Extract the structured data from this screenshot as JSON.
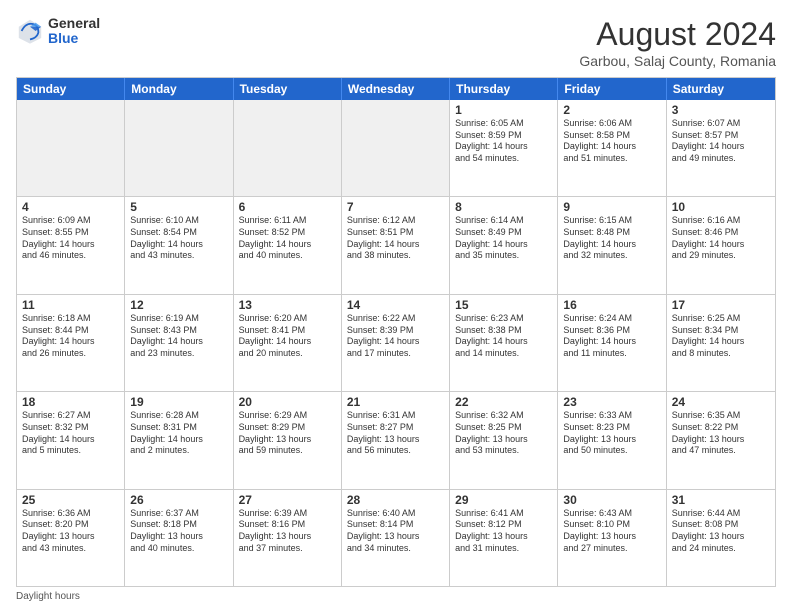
{
  "logo": {
    "general": "General",
    "blue": "Blue"
  },
  "title": "August 2024",
  "location": "Garbou, Salaj County, Romania",
  "days_of_week": [
    "Sunday",
    "Monday",
    "Tuesday",
    "Wednesday",
    "Thursday",
    "Friday",
    "Saturday"
  ],
  "footer": "Daylight hours",
  "weeks": [
    [
      {
        "day": "",
        "info": "",
        "shaded": true
      },
      {
        "day": "",
        "info": "",
        "shaded": true
      },
      {
        "day": "",
        "info": "",
        "shaded": true
      },
      {
        "day": "",
        "info": "",
        "shaded": true
      },
      {
        "day": "1",
        "info": "Sunrise: 6:05 AM\nSunset: 8:59 PM\nDaylight: 14 hours\nand 54 minutes."
      },
      {
        "day": "2",
        "info": "Sunrise: 6:06 AM\nSunset: 8:58 PM\nDaylight: 14 hours\nand 51 minutes."
      },
      {
        "day": "3",
        "info": "Sunrise: 6:07 AM\nSunset: 8:57 PM\nDaylight: 14 hours\nand 49 minutes."
      }
    ],
    [
      {
        "day": "4",
        "info": "Sunrise: 6:09 AM\nSunset: 8:55 PM\nDaylight: 14 hours\nand 46 minutes."
      },
      {
        "day": "5",
        "info": "Sunrise: 6:10 AM\nSunset: 8:54 PM\nDaylight: 14 hours\nand 43 minutes."
      },
      {
        "day": "6",
        "info": "Sunrise: 6:11 AM\nSunset: 8:52 PM\nDaylight: 14 hours\nand 40 minutes."
      },
      {
        "day": "7",
        "info": "Sunrise: 6:12 AM\nSunset: 8:51 PM\nDaylight: 14 hours\nand 38 minutes."
      },
      {
        "day": "8",
        "info": "Sunrise: 6:14 AM\nSunset: 8:49 PM\nDaylight: 14 hours\nand 35 minutes."
      },
      {
        "day": "9",
        "info": "Sunrise: 6:15 AM\nSunset: 8:48 PM\nDaylight: 14 hours\nand 32 minutes."
      },
      {
        "day": "10",
        "info": "Sunrise: 6:16 AM\nSunset: 8:46 PM\nDaylight: 14 hours\nand 29 minutes."
      }
    ],
    [
      {
        "day": "11",
        "info": "Sunrise: 6:18 AM\nSunset: 8:44 PM\nDaylight: 14 hours\nand 26 minutes."
      },
      {
        "day": "12",
        "info": "Sunrise: 6:19 AM\nSunset: 8:43 PM\nDaylight: 14 hours\nand 23 minutes."
      },
      {
        "day": "13",
        "info": "Sunrise: 6:20 AM\nSunset: 8:41 PM\nDaylight: 14 hours\nand 20 minutes."
      },
      {
        "day": "14",
        "info": "Sunrise: 6:22 AM\nSunset: 8:39 PM\nDaylight: 14 hours\nand 17 minutes."
      },
      {
        "day": "15",
        "info": "Sunrise: 6:23 AM\nSunset: 8:38 PM\nDaylight: 14 hours\nand 14 minutes."
      },
      {
        "day": "16",
        "info": "Sunrise: 6:24 AM\nSunset: 8:36 PM\nDaylight: 14 hours\nand 11 minutes."
      },
      {
        "day": "17",
        "info": "Sunrise: 6:25 AM\nSunset: 8:34 PM\nDaylight: 14 hours\nand 8 minutes."
      }
    ],
    [
      {
        "day": "18",
        "info": "Sunrise: 6:27 AM\nSunset: 8:32 PM\nDaylight: 14 hours\nand 5 minutes."
      },
      {
        "day": "19",
        "info": "Sunrise: 6:28 AM\nSunset: 8:31 PM\nDaylight: 14 hours\nand 2 minutes."
      },
      {
        "day": "20",
        "info": "Sunrise: 6:29 AM\nSunset: 8:29 PM\nDaylight: 13 hours\nand 59 minutes."
      },
      {
        "day": "21",
        "info": "Sunrise: 6:31 AM\nSunset: 8:27 PM\nDaylight: 13 hours\nand 56 minutes."
      },
      {
        "day": "22",
        "info": "Sunrise: 6:32 AM\nSunset: 8:25 PM\nDaylight: 13 hours\nand 53 minutes."
      },
      {
        "day": "23",
        "info": "Sunrise: 6:33 AM\nSunset: 8:23 PM\nDaylight: 13 hours\nand 50 minutes."
      },
      {
        "day": "24",
        "info": "Sunrise: 6:35 AM\nSunset: 8:22 PM\nDaylight: 13 hours\nand 47 minutes."
      }
    ],
    [
      {
        "day": "25",
        "info": "Sunrise: 6:36 AM\nSunset: 8:20 PM\nDaylight: 13 hours\nand 43 minutes."
      },
      {
        "day": "26",
        "info": "Sunrise: 6:37 AM\nSunset: 8:18 PM\nDaylight: 13 hours\nand 40 minutes."
      },
      {
        "day": "27",
        "info": "Sunrise: 6:39 AM\nSunset: 8:16 PM\nDaylight: 13 hours\nand 37 minutes."
      },
      {
        "day": "28",
        "info": "Sunrise: 6:40 AM\nSunset: 8:14 PM\nDaylight: 13 hours\nand 34 minutes."
      },
      {
        "day": "29",
        "info": "Sunrise: 6:41 AM\nSunset: 8:12 PM\nDaylight: 13 hours\nand 31 minutes."
      },
      {
        "day": "30",
        "info": "Sunrise: 6:43 AM\nSunset: 8:10 PM\nDaylight: 13 hours\nand 27 minutes."
      },
      {
        "day": "31",
        "info": "Sunrise: 6:44 AM\nSunset: 8:08 PM\nDaylight: 13 hours\nand 24 minutes."
      }
    ]
  ]
}
